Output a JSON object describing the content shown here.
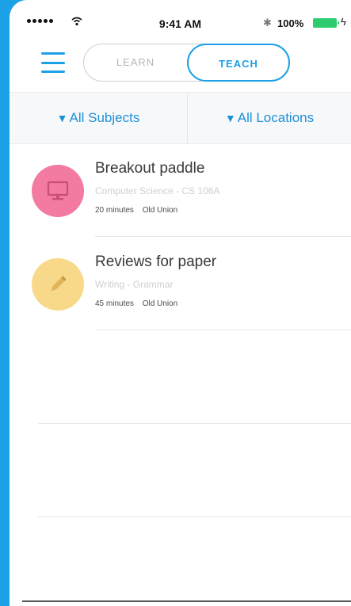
{
  "status_bar": {
    "time": "9:41 AM",
    "battery": "100%",
    "bluetooth_icon": "bluetooth-icon",
    "bolt_icon": "charging-bolt-icon"
  },
  "nav": {
    "menu_icon": "hamburger-menu-icon",
    "tabs": [
      {
        "label": "LEARN",
        "selected": false
      },
      {
        "label": "TEACH",
        "selected": true
      }
    ]
  },
  "filters": {
    "subjects": "All Subjects",
    "locations": "All Locations",
    "arrow": "▼"
  },
  "items": [
    {
      "title": "Breakout paddle",
      "subtitle": "Computer Science - CS 106A",
      "duration": "20 minutes",
      "location": "Old Union",
      "icon": "monitor-icon",
      "color": "#f37aa0"
    },
    {
      "title": "Reviews for paper",
      "subtitle": "Writing - Grammar",
      "duration": "45 minutes",
      "location": "Old Union",
      "icon": "pencil-icon",
      "color": "#f8d98a"
    }
  ],
  "colors": {
    "accent": "#1da1e6",
    "background": "#1da1e6"
  }
}
